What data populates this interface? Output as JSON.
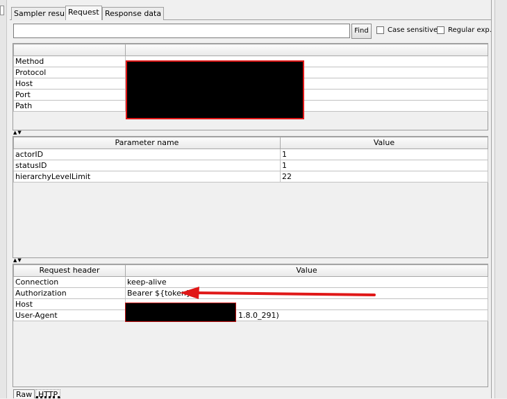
{
  "tabs": [
    "Sampler result",
    "Request",
    "Response data"
  ],
  "active_tab": "Request",
  "search": {
    "value": "",
    "placeholder": "",
    "find_label": "Find",
    "case_sensitive_label": "Case sensitive",
    "regex_label": "Regular exp."
  },
  "request_info": {
    "headers": [
      "",
      ""
    ],
    "rows": [
      {
        "key": "Method",
        "value": ""
      },
      {
        "key": "Protocol",
        "value": ""
      },
      {
        "key": "Host",
        "value": ""
      },
      {
        "key": "Port",
        "value": ""
      },
      {
        "key": "Path",
        "value": ""
      }
    ]
  },
  "parameters": {
    "headers": [
      "Parameter name",
      "Value"
    ],
    "rows": [
      {
        "name": "actorID",
        "value": "1"
      },
      {
        "name": "statusID",
        "value": "1"
      },
      {
        "name": "hierarchyLevelLimit",
        "value": "22"
      }
    ]
  },
  "request_headers": {
    "headers": [
      "Request header",
      "Value"
    ],
    "rows": [
      {
        "name": "Connection",
        "value": "keep-alive"
      },
      {
        "name": "Authorization",
        "value": "Bearer ${token}"
      },
      {
        "name": "Host",
        "value": ""
      },
      {
        "name": "User-Agent",
        "value": "1.8.0_291)"
      }
    ]
  },
  "bottom_tabs": [
    "Raw",
    "HTTP"
  ],
  "colors": {
    "annotation_red": "#e01818",
    "redaction": "#000000"
  },
  "icons": [
    "split-arrows-icon",
    "annotation-arrow-icon"
  ]
}
